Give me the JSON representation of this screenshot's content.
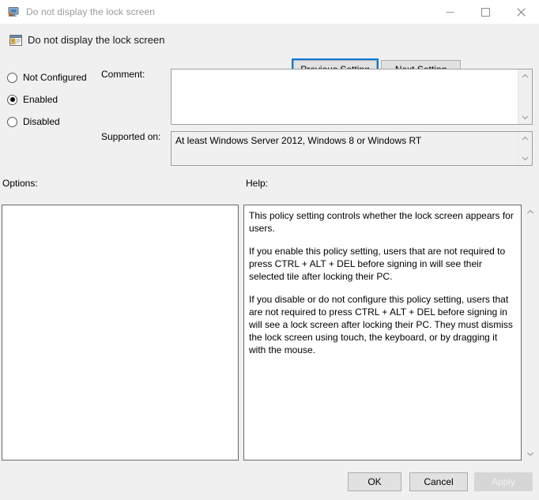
{
  "window": {
    "title": "Do not display the lock screen",
    "icon": "policy-monitor-icon",
    "controls": {
      "minimize": "minimize-icon",
      "maximize": "maximize-icon",
      "close": "close-icon"
    }
  },
  "header": {
    "policy_icon": "group-policy-setting-icon",
    "policy_title": "Do not display the lock screen",
    "previous_button": "Previous Setting",
    "next_button": "Next Setting"
  },
  "state": {
    "options": [
      {
        "label": "Not Configured",
        "selected": false
      },
      {
        "label": "Enabled",
        "selected": true
      },
      {
        "label": "Disabled",
        "selected": false
      }
    ]
  },
  "fields": {
    "comment_label": "Comment:",
    "comment_value": "",
    "supported_label": "Supported on:",
    "supported_value": "At least Windows Server 2012, Windows 8 or Windows RT"
  },
  "panels": {
    "options_label": "Options:",
    "help_label": "Help:",
    "options_content": "",
    "help_paragraphs": [
      "This policy setting controls whether the lock screen appears for users.",
      "If you enable this policy setting, users that are not required to press CTRL + ALT + DEL before signing in will see their selected tile after locking their PC.",
      "If you disable or do not configure this policy setting, users that are not required to press CTRL + ALT + DEL before signing in will see a lock screen after locking their PC. They must dismiss the lock screen using touch, the keyboard, or by dragging it with the mouse."
    ]
  },
  "footer": {
    "ok": "OK",
    "cancel": "Cancel",
    "apply": "Apply",
    "apply_disabled": true
  },
  "colors": {
    "focus_accent": "#0078d7",
    "window_background": "#f0f0f0",
    "titlebar_background": "#ffffff",
    "panel_background": "#ffffff",
    "disabled_text": "#f3f3f3",
    "title_text": "#9a9a9a"
  }
}
